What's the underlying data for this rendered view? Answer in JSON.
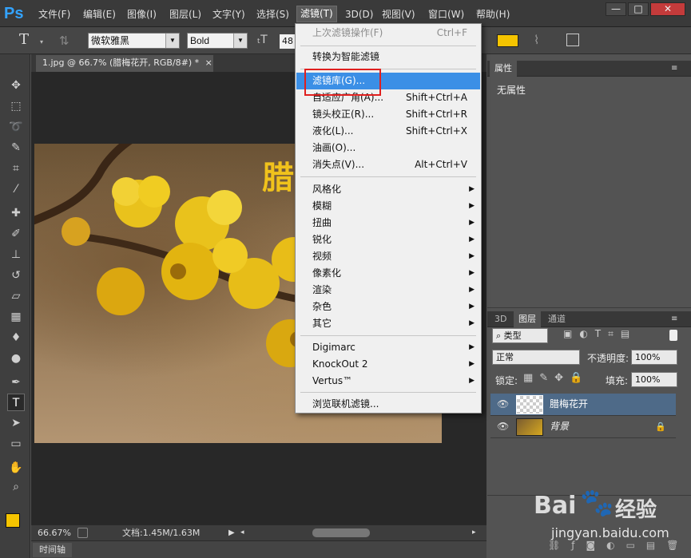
{
  "app": {
    "logo": "Ps"
  },
  "menubar": {
    "items": [
      "文件(F)",
      "编辑(E)",
      "图像(I)",
      "图层(L)",
      "文字(Y)",
      "选择(S)",
      "滤镜(T)",
      "3D(D)",
      "视图(V)",
      "窗口(W)",
      "帮助(H)"
    ],
    "active_index": 6,
    "window_buttons": [
      "—",
      "□",
      "✕"
    ]
  },
  "options_bar": {
    "tool_glyph": "T",
    "font_family": "微软雅黑",
    "font_style": "Bold",
    "font_size_prefix": "48"
  },
  "document": {
    "tab_title": "1.jpg @ 66.7% (腊梅花开, RGB/8#) *",
    "tab_close": "×",
    "text_layer_preview": "腊"
  },
  "status": {
    "zoom": "66.67%",
    "doc_info": "文档:1.45M/1.63M"
  },
  "timeline": {
    "label": "时间轴"
  },
  "properties_panel": {
    "title": "属性",
    "content": "无属性"
  },
  "layers_panel": {
    "tabs": [
      "3D",
      "图层",
      "通道"
    ],
    "active_tab": 1,
    "filter_kind": "类型",
    "blend_mode": "正常",
    "opacity_label": "不透明度:",
    "opacity_value": "100%",
    "lock_label": "锁定:",
    "fill_label": "填充:",
    "fill_value": "100%",
    "layers": [
      {
        "name": "腊梅花开",
        "selected": true,
        "locked": false
      },
      {
        "name": "背景",
        "selected": false,
        "locked": true
      }
    ],
    "footer_icons": [
      "link-icon",
      "fx-icon",
      "mask-icon",
      "adjustment-icon",
      "folder-icon",
      "new-layer-icon",
      "trash-icon"
    ]
  },
  "filter_menu": {
    "items": [
      {
        "label": "上次滤镜操作(F)",
        "shortcut": "Ctrl+F",
        "disabled": true
      },
      {
        "label": "转换为智能滤镜"
      },
      {
        "label": "滤镜库(G)...",
        "highlighted": true
      },
      {
        "label": "自适应广角(A)...",
        "shortcut": "Shift+Ctrl+A"
      },
      {
        "label": "镜头校正(R)...",
        "shortcut": "Shift+Ctrl+R"
      },
      {
        "label": "液化(L)...",
        "shortcut": "Shift+Ctrl+X"
      },
      {
        "label": "油画(O)..."
      },
      {
        "label": "消失点(V)...",
        "shortcut": "Alt+Ctrl+V"
      },
      {
        "label": "风格化",
        "submenu": true
      },
      {
        "label": "模糊",
        "submenu": true
      },
      {
        "label": "扭曲",
        "submenu": true
      },
      {
        "label": "锐化",
        "submenu": true
      },
      {
        "label": "视频",
        "submenu": true
      },
      {
        "label": "像素化",
        "submenu": true
      },
      {
        "label": "渲染",
        "submenu": true
      },
      {
        "label": "杂色",
        "submenu": true
      },
      {
        "label": "其它",
        "submenu": true
      },
      {
        "label": "Digimarc",
        "submenu": true
      },
      {
        "label": "KnockOut 2",
        "submenu": true
      },
      {
        "label": "Vertus™",
        "submenu": true
      },
      {
        "label": "浏览联机滤镜..."
      }
    ]
  },
  "watermark": {
    "brand": "Bai",
    "brand2": "经验",
    "url": "jingyan.baidu.com"
  },
  "colors": {
    "highlight": "#3b8fe6",
    "redbox": "#e0201f",
    "foreground_swatch": "#f5c400",
    "ps_logo": "#33a3ff"
  }
}
